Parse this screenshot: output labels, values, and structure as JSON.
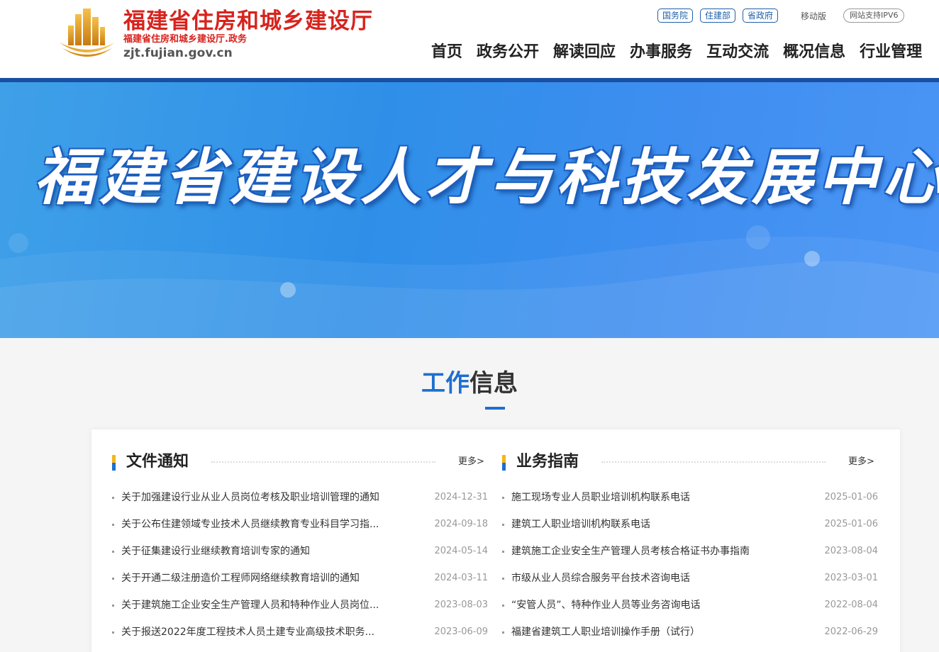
{
  "header": {
    "site_title": "福建省住房和城乡建设厅",
    "site_subtitle": "福建省住房和城乡建设厅.政务",
    "domain": "zjt.fujian.gov.cn",
    "top_links": [
      "国务院",
      "住建部",
      "省政府"
    ],
    "mobile_label": "移动版",
    "ipv6_label": "网站支持IPV6",
    "nav": [
      "首页",
      "政务公开",
      "解读回应",
      "办事服务",
      "互动交流",
      "概况信息",
      "行业管理"
    ]
  },
  "banner": {
    "title": "福建省建设人才与科技发展中心"
  },
  "section": {
    "title_blue": "工作",
    "title_dark": "信息"
  },
  "columns": [
    {
      "title": "文件通知",
      "more": "更多>",
      "items": [
        {
          "title": "关于加强建设行业从业人员岗位考核及职业培训管理的通知",
          "date": "2024-12-31"
        },
        {
          "title": "关于公布住建领域专业技术人员继续教育专业科目学习指...",
          "date": "2024-09-18"
        },
        {
          "title": "关于征集建设行业继续教育培训专家的通知",
          "date": "2024-05-14"
        },
        {
          "title": "关于开通二级注册造价工程师网络继续教育培训的通知",
          "date": "2024-03-11"
        },
        {
          "title": "关于建筑施工企业安全生产管理人员和特种作业人员岗位...",
          "date": "2023-08-03"
        },
        {
          "title": "关于报送2022年度工程技术人员土建专业高级技术职务...",
          "date": "2023-06-09"
        }
      ]
    },
    {
      "title": "业务指南",
      "more": "更多>",
      "items": [
        {
          "title": "施工现场专业人员职业培训机构联系电话",
          "date": "2025-01-06"
        },
        {
          "title": "建筑工人职业培训机构联系电话",
          "date": "2025-01-06"
        },
        {
          "title": "建筑施工企业安全生产管理人员考核合格证书办事指南",
          "date": "2023-08-04"
        },
        {
          "title": "市级从业人员综合服务平台技术咨询电话",
          "date": "2023-03-01"
        },
        {
          "title": "“安管人员”、特种作业人员等业务咨询电话",
          "date": "2022-08-04"
        },
        {
          "title": "福建省建筑工人职业培训操作手册（试行）",
          "date": "2022-06-29"
        }
      ]
    }
  ],
  "colors": {
    "brand_red": "#d7231d",
    "brand_blue": "#1e6fcf",
    "accent_yellow": "#f5b51a",
    "header_bar": "#1a4fa3"
  },
  "icons": {
    "logo": "building-emblem-icon"
  }
}
